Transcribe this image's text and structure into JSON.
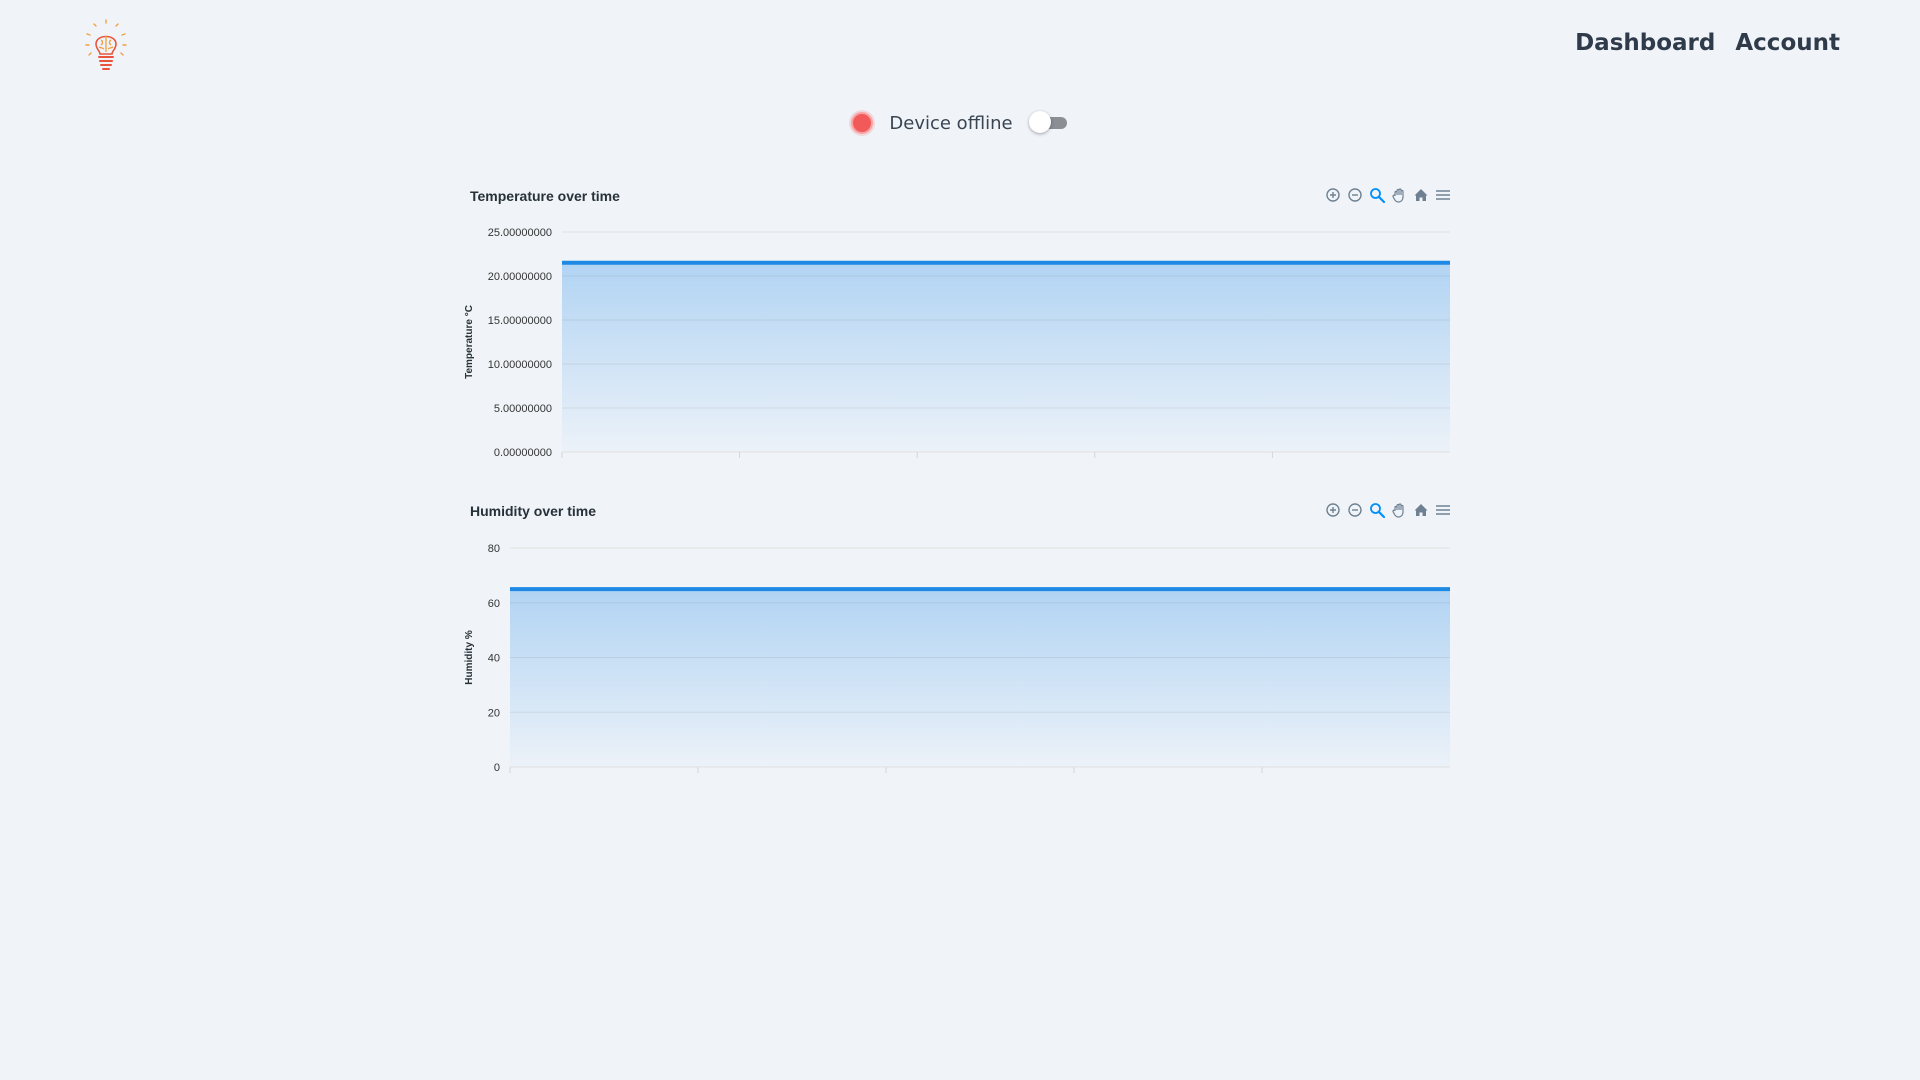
{
  "nav": {
    "dashboard": "Dashboard",
    "account": "Account"
  },
  "status": {
    "text": "Device offline",
    "online": false,
    "dot_color": "#f25a5a"
  },
  "colors": {
    "accent": "#1e88e5",
    "grid": "#e0e0e0",
    "tick": "#333333"
  },
  "toolbar_icons": [
    "zoom-in-icon",
    "zoom-out-icon",
    "zoom-select-icon",
    "pan-hand-icon",
    "reset-home-icon",
    "menu-icon"
  ],
  "chart_data": [
    {
      "type": "area",
      "title": "Temperature over time",
      "ylabel": "Temperature °C",
      "xlabel": "",
      "ylim": [
        0,
        25
      ],
      "y_ticks": [
        "25.00000000",
        "20.00000000",
        "15.00000000",
        "10.00000000",
        "5.00000000",
        "0.00000000"
      ],
      "y_tick_values": [
        25,
        20,
        15,
        10,
        5,
        0
      ],
      "x_tick_count": 6,
      "series": [
        {
          "values": [
            21.5,
            21.5
          ]
        }
      ]
    },
    {
      "type": "area",
      "title": "Humidity over time",
      "ylabel": "Humidity %",
      "xlabel": "",
      "ylim": [
        0,
        80
      ],
      "y_ticks": [
        "80",
        "60",
        "40",
        "20",
        "0"
      ],
      "y_tick_values": [
        80,
        60,
        40,
        20,
        0
      ],
      "x_tick_count": 6,
      "series": [
        {
          "values": [
            65,
            65
          ]
        }
      ]
    }
  ]
}
